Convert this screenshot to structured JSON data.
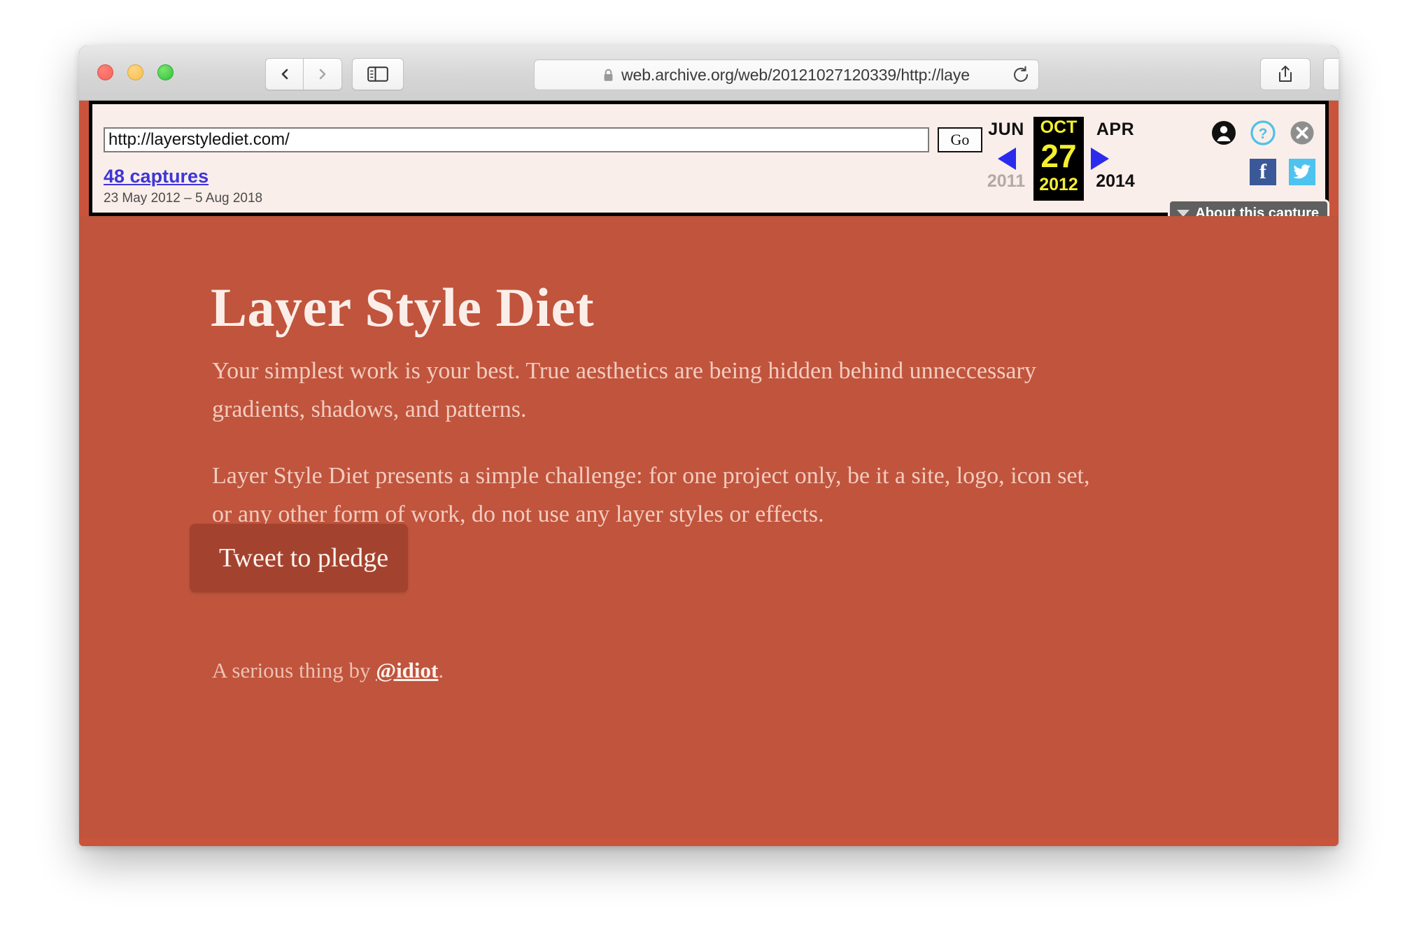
{
  "browser": {
    "address_url": "web.archive.org/web/20121027120339/http://laye",
    "lock_icon": "lock-icon",
    "back_icon": "chevron-left-icon",
    "forward_icon": "chevron-right-icon",
    "sidebar_icon": "sidebar-icon",
    "reload_icon": "reload-icon",
    "share_icon": "share-icon",
    "tabs_icon": "tab-overview-icon",
    "new_tab_label": "+"
  },
  "wayback": {
    "url_value": "http://layerstylediet.com/",
    "url_placeholder": "http://",
    "go_label": "Go",
    "captures_label": "48 captures",
    "date_range": "23 May 2012 – 5 Aug 2018",
    "prev": {
      "month": "JUN",
      "year": "2011"
    },
    "current": {
      "month": "OCT",
      "day": "27",
      "year": "2012"
    },
    "next": {
      "month": "APR",
      "year": "2014"
    },
    "prev_arrow_icon": "arrow-left-icon",
    "next_arrow_icon": "arrow-right-icon",
    "about_capture_label": "About this capture",
    "icons": {
      "user": "user-account-icon",
      "help": "help-question-icon",
      "close": "close-x-icon",
      "facebook": "facebook-icon",
      "twitter": "twitter-icon"
    },
    "colors": {
      "banner_bg": "#faeeea",
      "link": "#3f35d6",
      "highlight_bg": "#000000",
      "highlight_text": "#f5ef2e",
      "arrow": "#2b2bee",
      "facebook": "#3b5998",
      "twitter": "#4ec3f0"
    }
  },
  "page": {
    "title": "Layer Style Diet",
    "paragraph_1": "Your simplest work is your best. True aesthetics are being hidden behind unneccessary gradients, shadows, and patterns.",
    "paragraph_2": "Layer Style Diet presents a simple challenge: for one project only, be it a site, logo, icon set, or any other form of work, do not use any layer styles or effects.",
    "pledge_button_label": "Tweet to pledge",
    "footer_prefix": "A serious thing by ",
    "footer_handle": "@idiot",
    "footer_suffix": ".",
    "colors": {
      "background": "#c0543c",
      "title_text": "#fbeee9",
      "body_text": "#f3ccc0",
      "button_bg": "#a3432f",
      "button_text": "#fdf4f0"
    }
  }
}
